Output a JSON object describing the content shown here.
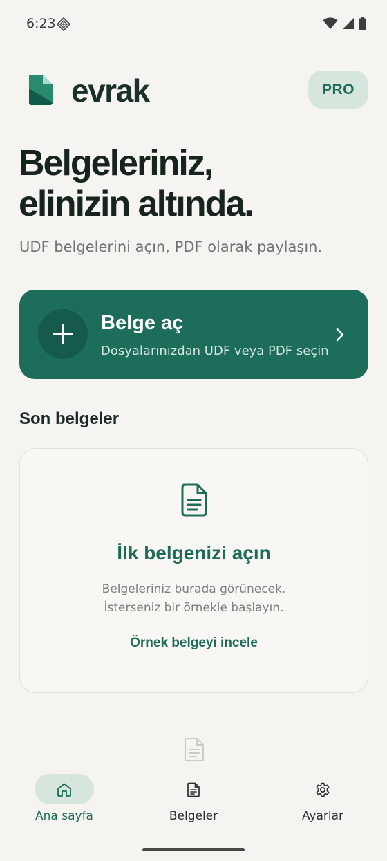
{
  "status_bar": {
    "time": "6:23"
  },
  "header": {
    "brand": "evrak",
    "pro_label": "PRO"
  },
  "hero": {
    "title_line1": "Belgeleriniz,",
    "title_line2": "elinizin altında.",
    "subtitle": "UDF belgelerini açın, PDF olarak paylaşın."
  },
  "open_card": {
    "title": "Belge aç",
    "description": "Dosyalarınızdan UDF veya PDF seçin"
  },
  "recent": {
    "section_title": "Son belgeler",
    "empty_title": "İlk belgenizi açın",
    "empty_line1": "Belgeleriniz burada görünecek.",
    "empty_line2": "İsterseniz bir örnekle başlayın.",
    "sample_link": "Örnek belgeyi incele"
  },
  "nav": {
    "items": [
      {
        "label": "Ana sayfa",
        "icon": "home-icon",
        "active": true
      },
      {
        "label": "Belgeler",
        "icon": "document-icon",
        "active": false
      },
      {
        "label": "Ayarlar",
        "icon": "gear-icon",
        "active": false
      }
    ]
  },
  "colors": {
    "accent": "#1d6d5b",
    "background": "#f5f4f0",
    "pill": "#d7e6dd"
  }
}
